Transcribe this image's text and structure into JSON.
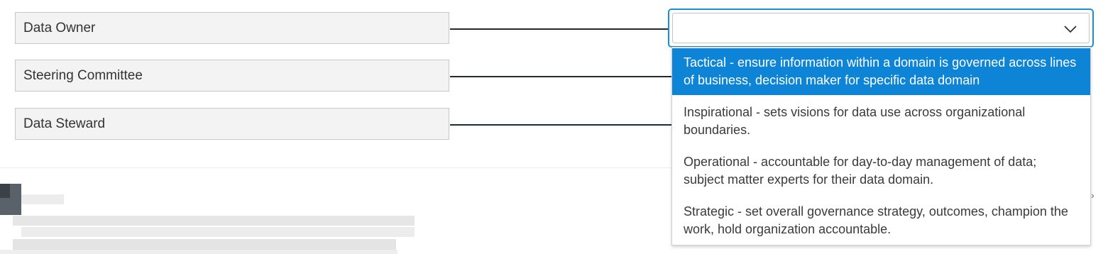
{
  "prompts": [
    {
      "label": "Data Owner"
    },
    {
      "label": "Steering Committee"
    },
    {
      "label": "Data Steward"
    }
  ],
  "select": {
    "current_value": "",
    "chevron_icon": "chevron-down-icon"
  },
  "dropdown": {
    "options": [
      {
        "label": "Tactical - ensure information within a domain is governed across lines of business, decision maker for specific data domain",
        "highlighted": true
      },
      {
        "label": "Inspirational - sets visions for data use across organizational boundaries.",
        "highlighted": false
      },
      {
        "label": "Operational - accountable for day-to-day management of data; subject matter experts for their data domain.",
        "highlighted": false
      },
      {
        "label": "Strategic - set overall governance strategy, outcomes, champion the work, hold organization accountable.",
        "highlighted": false
      }
    ]
  },
  "colors": {
    "accent": "#1b8fd6",
    "highlight": "#0d84d6",
    "prompt_bg": "#f3f3f3",
    "connector": "#1f2b33"
  },
  "edge_icon": "chevron-right-icon"
}
